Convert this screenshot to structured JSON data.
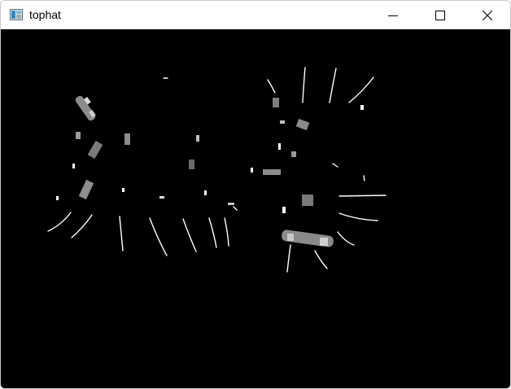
{
  "window": {
    "title": "tophat",
    "icon": "opencv-window-icon",
    "controls": {
      "minimize": "minimize-icon",
      "maximize": "maximize-icon",
      "close": "close-icon"
    }
  },
  "image": {
    "name": "tophat-result",
    "background_color": "#000000",
    "stroke_color": "#ffffff"
  }
}
